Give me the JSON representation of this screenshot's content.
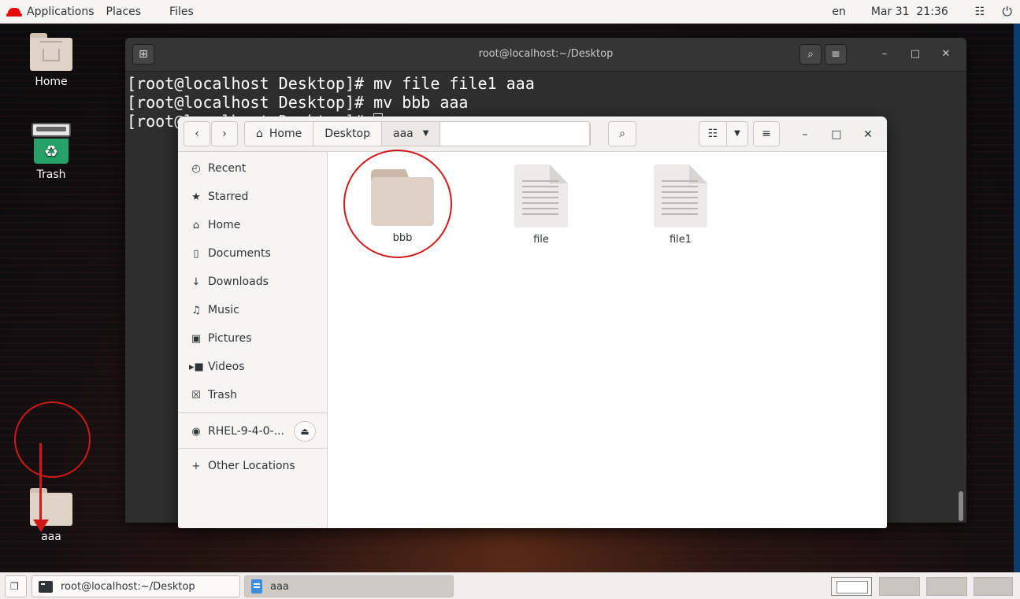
{
  "topbar": {
    "applications": "Applications",
    "places": "Places",
    "files": "Files",
    "language": "en",
    "datetime": "Mar 31  21:36",
    "network_icon": "network-icon",
    "power_icon": "power-icon"
  },
  "desktop": {
    "icons": [
      {
        "label": "Home",
        "icon": "home-folder-icon"
      },
      {
        "label": "Trash",
        "icon": "trash-icon"
      },
      {
        "label": "aaa",
        "icon": "folder-icon"
      }
    ]
  },
  "terminal": {
    "title": "root@localhost:~/Desktop",
    "lines": [
      "[root@localhost Desktop]# mv file file1 aaa",
      "[root@localhost Desktop]# mv bbb aaa",
      "[root@localhost Desktop]# "
    ]
  },
  "file_manager": {
    "breadcrumbs": [
      "Home",
      "Desktop",
      "aaa"
    ],
    "sidebar": [
      {
        "label": "Recent",
        "icon": "clock-icon"
      },
      {
        "label": "Starred",
        "icon": "star-icon"
      },
      {
        "label": "Home",
        "icon": "home-icon"
      },
      {
        "label": "Documents",
        "icon": "document-icon"
      },
      {
        "label": "Downloads",
        "icon": "download-icon"
      },
      {
        "label": "Music",
        "icon": "music-icon"
      },
      {
        "label": "Pictures",
        "icon": "camera-icon"
      },
      {
        "label": "Videos",
        "icon": "video-icon"
      },
      {
        "label": "Trash",
        "icon": "trash-icon"
      }
    ],
    "device": {
      "label": "RHEL-9-4-0-...",
      "icon": "disc-icon"
    },
    "other_locations": "Other Locations",
    "items": [
      {
        "name": "bbb",
        "type": "folder"
      },
      {
        "name": "file",
        "type": "document"
      },
      {
        "name": "file1",
        "type": "document"
      }
    ]
  },
  "taskbar": {
    "tasks": [
      {
        "label": "root@localhost:~/Desktop",
        "icon": "terminal-icon"
      },
      {
        "label": "aaa",
        "icon": "file-manager-icon"
      }
    ]
  },
  "colors": {
    "annotation": "#d11818",
    "folder": "#ddd2c5",
    "terminal_bg": "#2e2e2e"
  }
}
